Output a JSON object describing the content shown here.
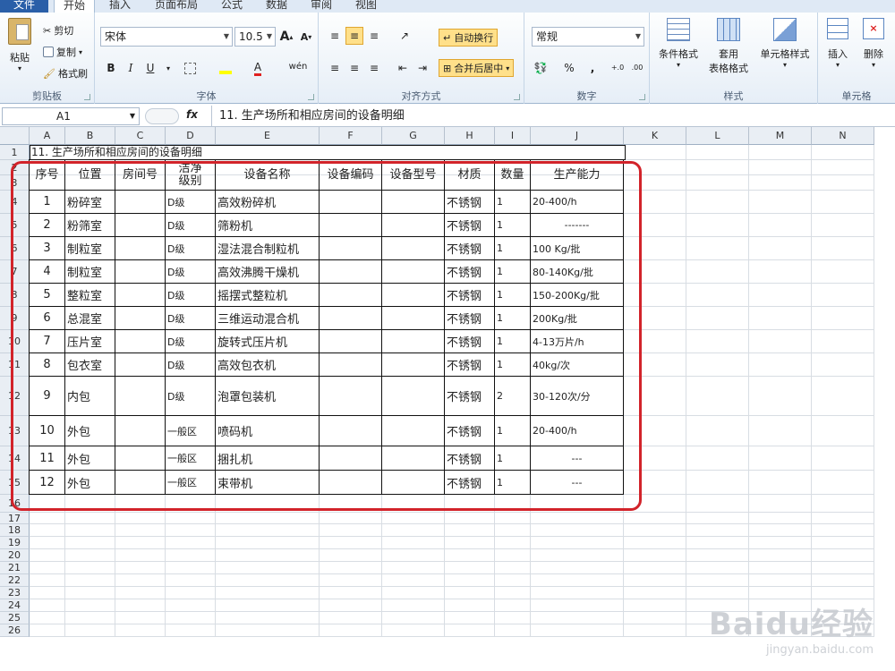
{
  "tabs": [
    "文件",
    "开始",
    "插入",
    "页面布局",
    "公式",
    "数据",
    "审阅",
    "视图"
  ],
  "clipboard": {
    "paste": "粘贴",
    "cut": "剪切",
    "copy": "复制",
    "painter": "格式刷",
    "label": "剪贴板"
  },
  "font": {
    "name": "宋体",
    "size": "10.5",
    "grow": "A",
    "shrink": "A",
    "bold": "B",
    "italic": "I",
    "underline": "U",
    "wen": "wén",
    "label": "字体",
    "font_color": "#e02020",
    "fill_color": "#ffff00"
  },
  "alignment": {
    "wrap": "自动换行",
    "merge": "合并后居中",
    "label": "对齐方式"
  },
  "number": {
    "format": "常规",
    "percent": "%",
    "comma": ",",
    "inc": "+.0\n.00",
    "dec": ".00\n+.0",
    "label": "数字"
  },
  "styles": {
    "conditional": "条件格式",
    "table_line1": "套用",
    "table_line2": "表格格式",
    "cell_styles": "单元格样式",
    "label": "样式"
  },
  "cells": {
    "insert": "插入",
    "delete": "删除",
    "label": "单元格"
  },
  "formula_bar": {
    "name_box": "A1",
    "fx": "fx",
    "content": "11.    生产场所和相应房间的设备明细"
  },
  "columns": [
    "A",
    "B",
    "C",
    "D",
    "E",
    "F",
    "G",
    "H",
    "I",
    "J",
    "K",
    "L",
    "M",
    "N"
  ],
  "title": "11. 生产场所和相应房间的设备明细",
  "headers": [
    "序号",
    "位置",
    "房间号",
    "洁净\n级别",
    "设备名称",
    "设备编码",
    "设备型号",
    "材质",
    "数量",
    "生产能力"
  ],
  "rows": [
    [
      "1",
      "粉碎室",
      "",
      "D级",
      "高效粉碎机",
      "",
      "",
      "不锈钢",
      "1",
      "20-400/h"
    ],
    [
      "2",
      "粉筛室",
      "",
      "D级",
      "筛粉机",
      "",
      "",
      "不锈钢",
      "1",
      "-------"
    ],
    [
      "3",
      "制粒室",
      "",
      "D级",
      "湿法混合制粒机",
      "",
      "",
      "不锈钢",
      "1",
      "100 Kg/批"
    ],
    [
      "4",
      "制粒室",
      "",
      "D级",
      "高效沸腾干燥机",
      "",
      "",
      "不锈钢",
      "1",
      "80-140Kg/批"
    ],
    [
      "5",
      "整粒室",
      "",
      "D级",
      "摇摆式整粒机",
      "",
      "",
      "不锈钢",
      "1",
      "150-200Kg/批"
    ],
    [
      "6",
      "总混室",
      "",
      "D级",
      "三维运动混合机",
      "",
      "",
      "不锈钢",
      "1",
      "200Kg/批"
    ],
    [
      "7",
      "压片室",
      "",
      "D级",
      "旋转式压片机",
      "",
      "",
      "不锈钢",
      "1",
      "4-13万片/h"
    ],
    [
      "8",
      "包衣室",
      "",
      "D级",
      "高效包衣机",
      "",
      "",
      "不锈钢",
      "1",
      "40kg/次"
    ],
    [
      "9",
      "内包",
      "",
      "D级",
      "泡罩包装机",
      "",
      "",
      "不锈钢",
      "2",
      "30-120次/分"
    ],
    [
      "10",
      "外包",
      "",
      "一般区",
      "喷码机",
      "",
      "",
      "不锈钢",
      "1",
      "20-400/h"
    ],
    [
      "11",
      "外包",
      "",
      "一般区",
      "捆扎机",
      "",
      "",
      "不锈钢",
      "1",
      "---"
    ],
    [
      "12",
      "外包",
      "",
      "一般区",
      "束带机",
      "",
      "",
      "不锈钢",
      "1",
      "---"
    ]
  ],
  "row_numbers": [
    "1",
    "2",
    "3",
    "4",
    "5",
    "6",
    "7",
    "8",
    "9",
    "10",
    "11",
    "12",
    "13",
    "14",
    "15",
    "16",
    "17",
    "18",
    "19",
    "20",
    "21",
    "22",
    "23",
    "24",
    "25",
    "26"
  ],
  "watermark": {
    "brand": "Baidu经验",
    "url": "jingyan.baidu.com"
  }
}
